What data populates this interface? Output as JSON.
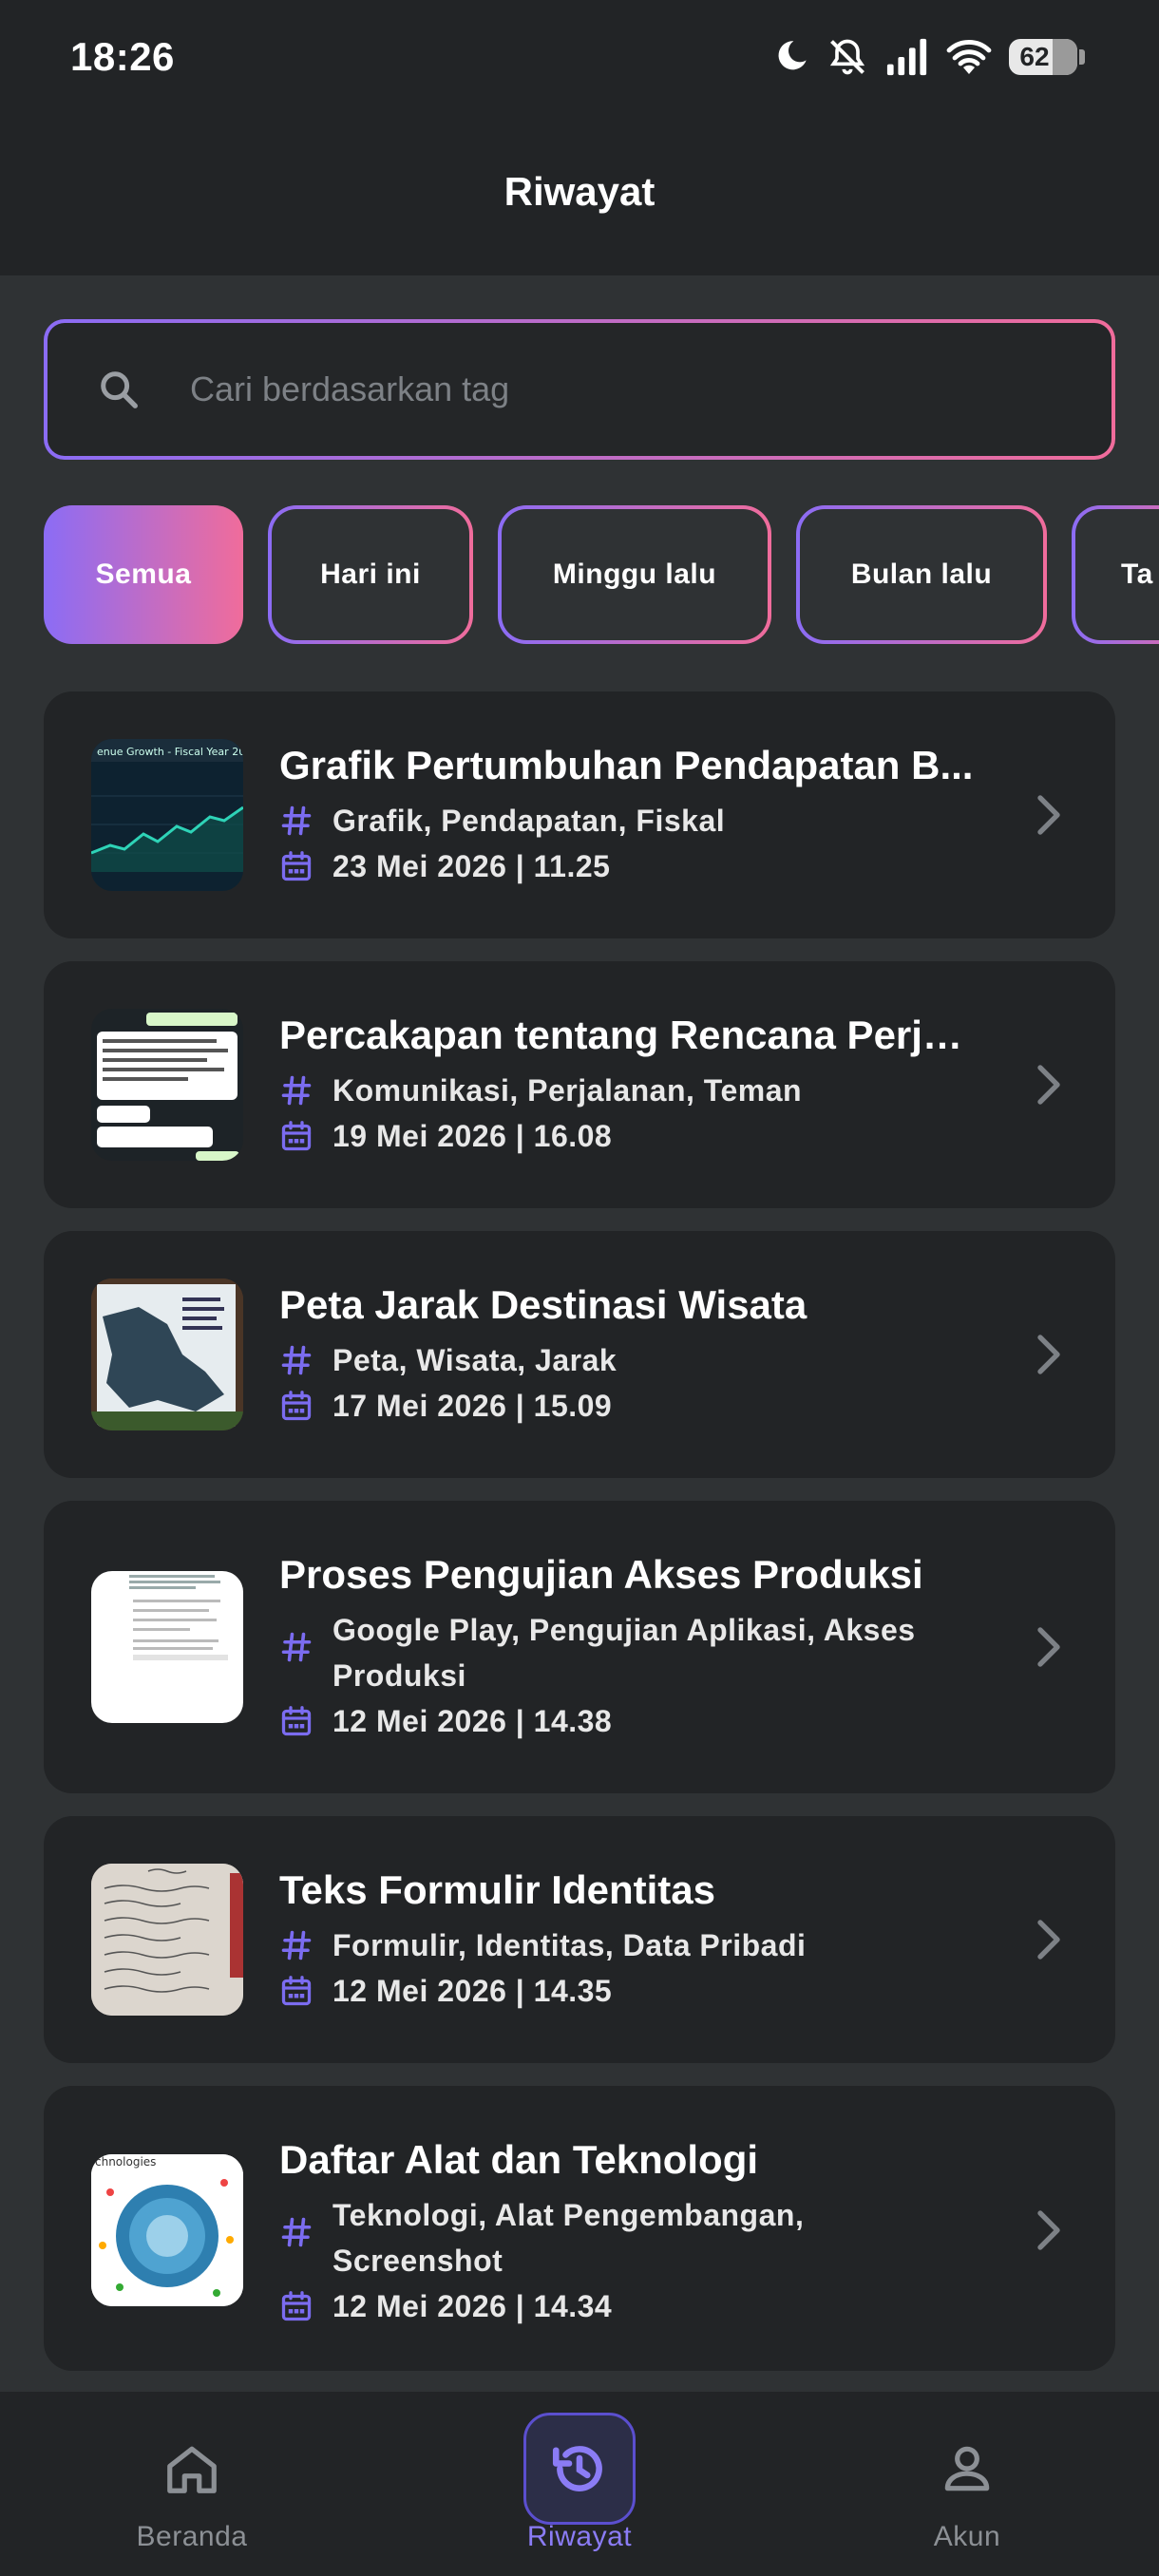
{
  "status_bar": {
    "time": "18:26",
    "battery": "62"
  },
  "header": {
    "title": "Riwayat"
  },
  "search": {
    "placeholder": "Cari berdasarkan tag"
  },
  "filters": [
    {
      "label": "Semua",
      "active": true
    },
    {
      "label": "Hari ini",
      "active": false
    },
    {
      "label": "Minggu lalu",
      "active": false
    },
    {
      "label": "Bulan lalu",
      "active": false
    },
    {
      "label": "Ta",
      "active": false
    }
  ],
  "items": [
    {
      "title": "Grafik Pertumbuhan Pendapatan B...",
      "tags": "Grafik, Pendapatan, Fiskal",
      "date": "23 Mei 2026 | 11.25",
      "thumb": "chart-thumbnail"
    },
    {
      "title": "Percakapan tentang Rencana Perjal...",
      "tags": "Komunikasi, Perjalanan, Teman",
      "date": "19 Mei 2026 | 16.08",
      "thumb": "chat-thumbnail"
    },
    {
      "title": "Peta Jarak Destinasi Wisata",
      "tags": "Peta, Wisata, Jarak",
      "date": "17 Mei 2026 | 15.09",
      "thumb": "map-thumbnail"
    },
    {
      "title": "Proses Pengujian Akses Produksi",
      "tags": "Google Play, Pengujian Aplikasi, Akses Produksi",
      "date": "12 Mei 2026 | 14.38",
      "thumb": "document-thumbnail"
    },
    {
      "title": "Teks Formulir Identitas",
      "tags": "Formulir, Identitas, Data Pribadi",
      "date": "12 Mei 2026 | 14.35",
      "thumb": "handwriting-thumbnail"
    },
    {
      "title": "Daftar Alat dan Teknologi",
      "tags": "Teknologi, Alat Pengembangan, Screenshot",
      "date": "12 Mei 2026 | 14.34",
      "thumb": "tech-thumbnail"
    }
  ],
  "nav": [
    {
      "label": "Beranda",
      "icon": "home-icon",
      "active": false
    },
    {
      "label": "Riwayat",
      "icon": "history-icon",
      "active": true
    },
    {
      "label": "Akun",
      "icon": "account-icon",
      "active": false
    }
  ],
  "colors": {
    "accent_start": "#8b6cf5",
    "accent_end": "#f06c9b",
    "icon_accent": "#7b6cf0",
    "card_bg": "#222426",
    "page_bg": "#2f3234"
  }
}
